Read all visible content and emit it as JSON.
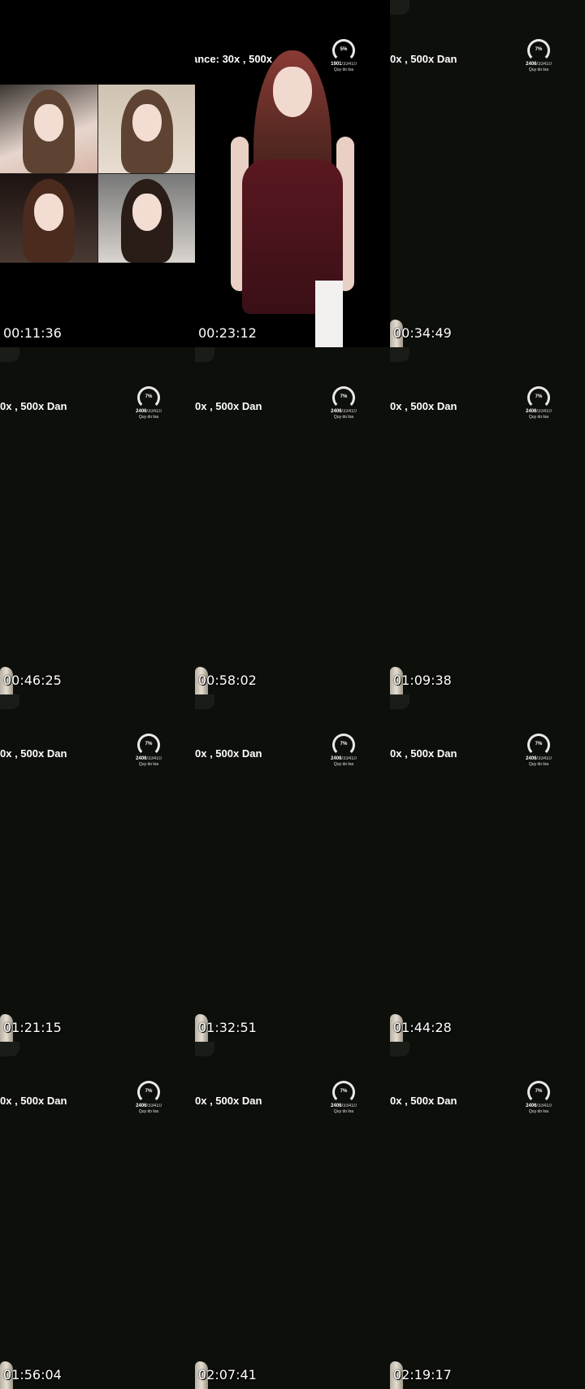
{
  "frames": [
    {
      "timestamp": "00:11:36",
      "kind": "collage"
    },
    {
      "timestamp": "00:23:12",
      "kind": "dancer",
      "banner": "ance: 30x , 500x",
      "gauge": {
        "percent": "5%",
        "count": "1901",
        "total": "/33410",
        "label": "Quy do loa"
      }
    },
    {
      "timestamp": "00:34:49",
      "kind": "empty",
      "banner": "0x , 500x   Dan",
      "gauge": {
        "percent": "7%",
        "count": "2406",
        "total": "/33410",
        "label": "Quy do loa"
      }
    },
    {
      "timestamp": "00:46:25",
      "kind": "empty",
      "banner": "0x , 500x   Dan",
      "gauge": {
        "percent": "7%",
        "count": "2406",
        "total": "/33410",
        "label": "Quy do loa"
      }
    },
    {
      "timestamp": "00:58:02",
      "kind": "empty",
      "banner": "0x , 500x   Dan",
      "gauge": {
        "percent": "7%",
        "count": "2406",
        "total": "/33410",
        "label": "Quy do loa"
      }
    },
    {
      "timestamp": "01:09:38",
      "kind": "empty",
      "banner": "0x , 500x   Dan",
      "gauge": {
        "percent": "7%",
        "count": "2406",
        "total": "/33410",
        "label": "Quy do loa"
      }
    },
    {
      "timestamp": "01:21:15",
      "kind": "empty",
      "banner": "0x , 500x   Dan",
      "gauge": {
        "percent": "7%",
        "count": "2406",
        "total": "/33410",
        "label": "Quy do loa"
      }
    },
    {
      "timestamp": "01:32:51",
      "kind": "empty",
      "banner": "0x , 500x   Dan",
      "gauge": {
        "percent": "7%",
        "count": "2406",
        "total": "/33410",
        "label": "Quy do loa"
      }
    },
    {
      "timestamp": "01:44:28",
      "kind": "empty",
      "banner": "0x , 500x   Dan",
      "gauge": {
        "percent": "7%",
        "count": "2406",
        "total": "/33410",
        "label": "Quy do loa"
      }
    },
    {
      "timestamp": "01:56:04",
      "kind": "empty",
      "banner": "0x , 500x   Dan",
      "gauge": {
        "percent": "7%",
        "count": "2406",
        "total": "/33410",
        "label": "Quy do loa"
      }
    },
    {
      "timestamp": "02:07:41",
      "kind": "empty",
      "banner": "0x , 500x   Dan",
      "gauge": {
        "percent": "7%",
        "count": "2406",
        "total": "/33410",
        "label": "Quy do loa"
      }
    },
    {
      "timestamp": "02:19:17",
      "kind": "empty",
      "banner": "0x , 500x   Dan",
      "gauge": {
        "percent": "7%",
        "count": "2406",
        "total": "/33410",
        "label": "Quy do loa"
      }
    }
  ]
}
